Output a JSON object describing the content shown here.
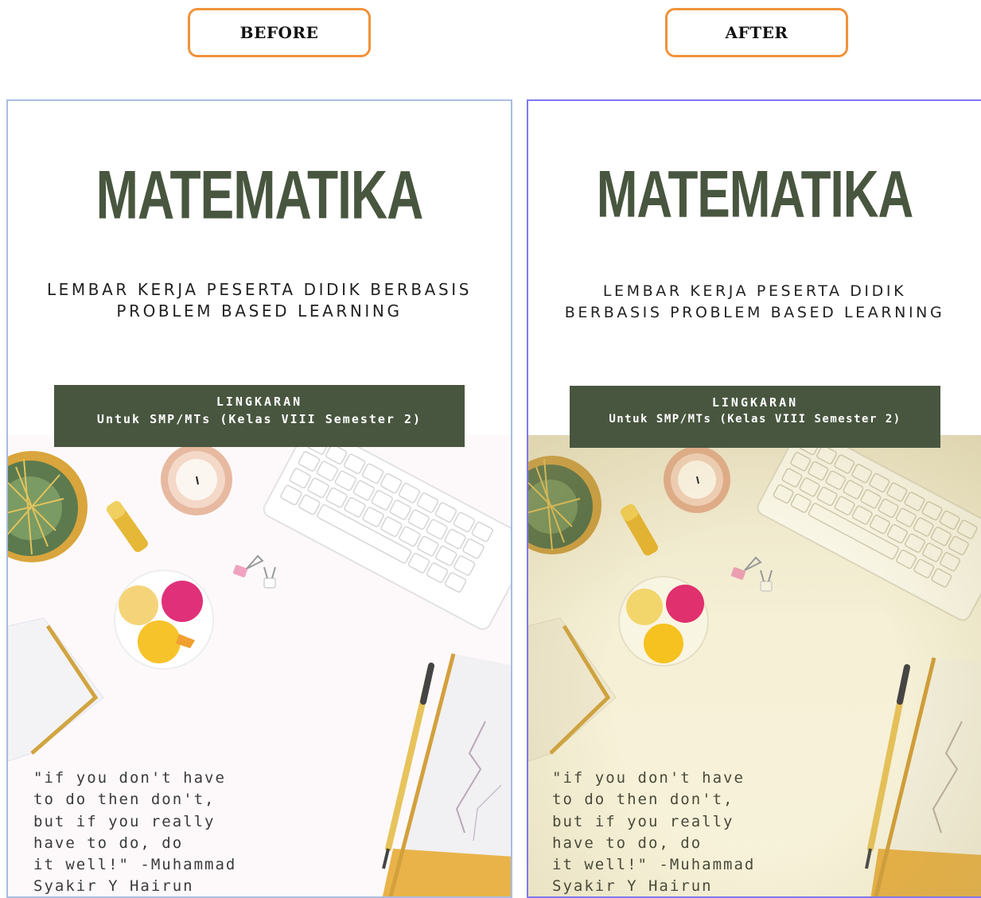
{
  "labels": {
    "before": "BEFORE",
    "after": "AFTER"
  },
  "cover": {
    "title": "MATEMATIKA",
    "subtitle": "LEMBAR KERJA PESERTA DIDIK BERBASIS PROBLEM BASED LEARNING",
    "banner_line1": "LINGKARAN",
    "banner_line2": "Untuk SMP/MTs (Kelas VIII Semester 2)",
    "quote": {
      "lines": [
        "\"if you don't have",
        "to do then don't,",
        "but if you really",
        "have to do, do",
        "it well!\" -Muhammad",
        "Syakir Y Hairun"
      ]
    }
  },
  "colors": {
    "label_border": "#f0923a",
    "title_green": "#48563f",
    "before_border": "#a9bde0",
    "after_border": "#7e78f0",
    "after_tint": "#f3edd3"
  },
  "icons": [
    "cactus-plant-icon",
    "candle-icon",
    "lip-balm-icon",
    "keyboard-icon",
    "binder-clip-icon",
    "macarons-plate-icon",
    "notebook-icon",
    "pen-icon",
    "marble-notebook-icon"
  ]
}
